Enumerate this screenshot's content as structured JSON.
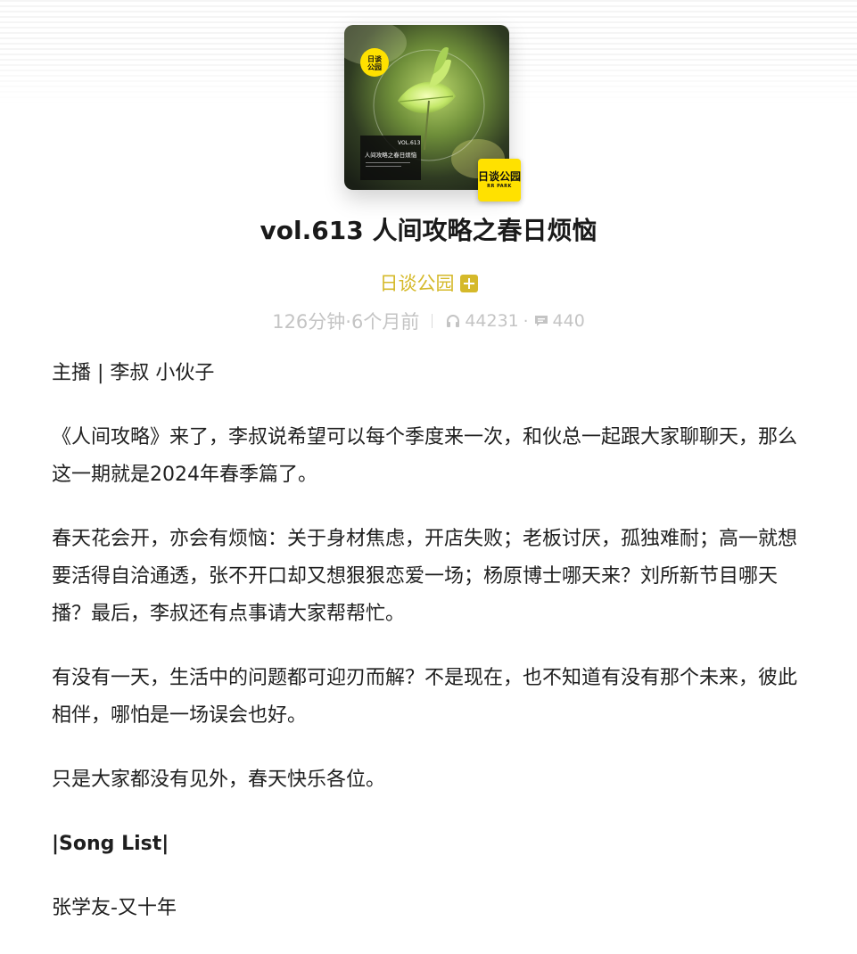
{
  "cover": {
    "logo_text": "日谈公园",
    "logo_sub": "RR PARK",
    "vol_text": "VOL.613",
    "card_title": "人间攻略之春日烦恼"
  },
  "episode": {
    "title": "vol.613 人间攻略之春日烦恼",
    "podcast_name": "日谈公园",
    "duration_age": "126分钟·6个月前",
    "listen_count": "44231",
    "separator": "·",
    "comment_count": "440"
  },
  "description": {
    "paragraphs": [
      "主播 | 李叔 小伙子",
      "《人间攻略》来了，李叔说希望可以每个季度来一次，和伙总一起跟大家聊聊天，那么这一期就是2024年春季篇了。",
      "春天花会开，亦会有烦恼：关于身材焦虑，开店失败；老板讨厌，孤独难耐；高一就想要活得自洽通透，张不开口却又想狠狠恋爱一场；杨原博士哪天来？刘所新节目哪天播？最后，李叔还有点事请大家帮帮忙。",
      "有没有一天，生活中的问题都可迎刃而解？不是现在，也不知道有没有那个未来，彼此相伴，哪怕是一场误会也好。",
      "只是大家都没有见外，春天快乐各位。",
      "|Song List|",
      "张学友-又十年"
    ]
  },
  "colors": {
    "accent": "#d5b92a",
    "muted": "#c4c4c4",
    "logo_yellow": "#ffe100"
  },
  "icons": {
    "headphones": "headphones-icon",
    "comment": "comment-icon",
    "plus": "plus-square-icon"
  }
}
